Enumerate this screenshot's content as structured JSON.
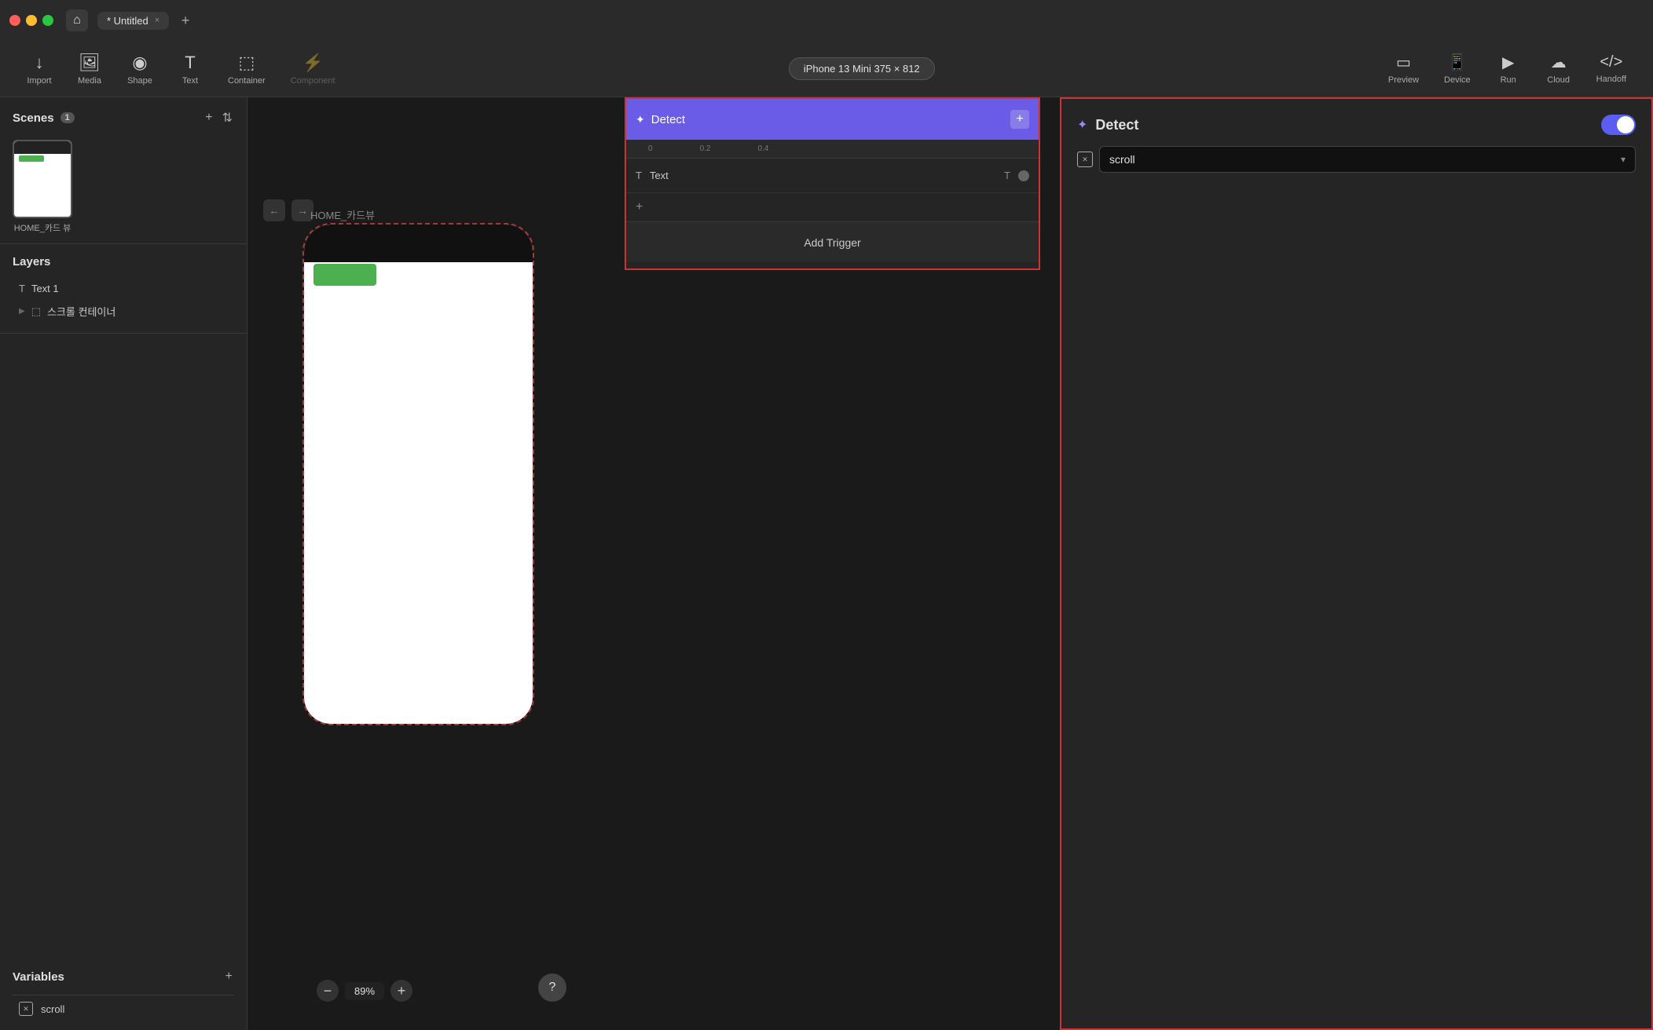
{
  "titlebar": {
    "tab_label": "* Untitled",
    "tab_close": "×",
    "tab_add": "+",
    "home_icon": "⌂"
  },
  "toolbar": {
    "import_label": "Import",
    "media_label": "Media",
    "shape_label": "Shape",
    "text_label": "Text",
    "container_label": "Container",
    "component_label": "Component",
    "device_name": "iPhone 13 Mini  375 × 812",
    "preview_label": "Preview",
    "device_label": "Device",
    "run_label": "Run",
    "cloud_label": "Cloud",
    "handoff_label": "Handoff"
  },
  "sidebar": {
    "scenes_title": "Scenes",
    "scenes_count": "1",
    "scene_name": "HOME_카드\n뷰",
    "layers_title": "Layers",
    "layer1_name": "Text 1",
    "layer2_name": "스크롤 컨테이너",
    "variables_title": "Variables",
    "variable1_name": "scroll",
    "plus_icon": "+",
    "sort_icon": "⇅"
  },
  "canvas": {
    "label": "HOME_카드뷰",
    "zoom_percent": "89%",
    "zoom_minus": "−",
    "zoom_plus": "+",
    "help": "?",
    "nav_back": "←",
    "nav_forward": "→"
  },
  "detect_panel": {
    "title": "Detect",
    "plus": "+",
    "timeline_row_icon": "T",
    "timeline_row_label": "Text",
    "timeline_row_end_icon": "T",
    "add_trigger_label": "Add Trigger",
    "ruler_marks": [
      "0",
      "0.2",
      "0.4"
    ]
  },
  "right_panel": {
    "title": "Detect",
    "icon": "✦",
    "scroll_label": "scroll",
    "scroll_arrow": "▾",
    "x_icon": "✕"
  },
  "colors": {
    "detect_header_bg": "#6b5ce7",
    "red_border": "#cc3333",
    "toggle_bg": "#5b5ef0",
    "green_element": "#4caf50"
  }
}
